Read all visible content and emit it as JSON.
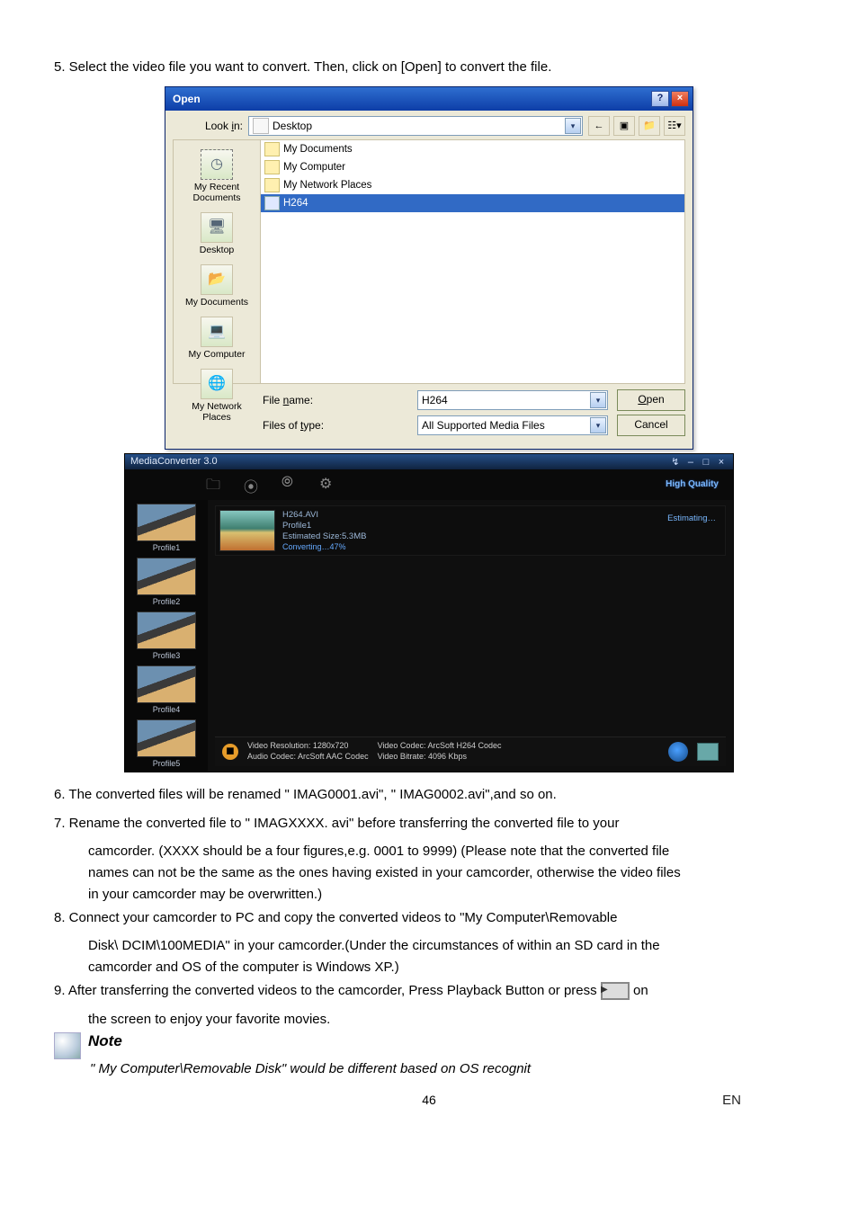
{
  "steps": {
    "s5": "5. Select the video file you want to convert. Then, click on [Open] to convert the file.",
    "s6": "6. The converted files will be renamed \" IMAG0001.avi\", \" IMAG0002.avi\",and so on.",
    "s7a": "7. Rename the converted file to \" IMAGXXXX. avi\" before transferring the converted file to your",
    "s7b": "camcorder. (XXXX should be a four figures,e.g. 0001 to 9999) (Please note that the converted file",
    "s7c": "names can not be the same as the ones having existed in your camcorder, otherwise the video files",
    "s7d": "in your camcorder may be overwritten.)",
    "s8a": "8. Connect your camcorder to PC and copy the converted videos to \"My Computer\\Removable",
    "s8b": "Disk\\ DCIM\\100MEDIA\" in your camcorder.(Under the circumstances of within an SD card in the",
    "s8c": "camcorder and OS of the computer is Windows XP.)",
    "s9a": "9. After transferring the converted videos to the camcorder, Press Playback Button or press ",
    "s9b": " on",
    "s9c": "the screen to enjoy your favorite movies."
  },
  "note": {
    "title": "Note",
    "body": "\" My Computer\\Removable Disk\" would be different based on OS recognit"
  },
  "open": {
    "title": "Open",
    "lookin_label": "Look in:",
    "lookin_value": "Desktop",
    "places": {
      "recent": "My Recent Documents",
      "desktop": "Desktop",
      "mydocs": "My Documents",
      "mycomp": "My Computer",
      "mynet": "My Network Places"
    },
    "items": {
      "mydocs": "My Documents",
      "mycomp": "My Computer",
      "mynet": "My Network Places",
      "h264": "H264"
    },
    "filename_label": "File name:",
    "filename_value": "H264",
    "filetype_label": "Files of type:",
    "filetype_value": "All Supported Media Files",
    "open_btn": "Open",
    "cancel_btn": "Cancel"
  },
  "mc": {
    "title": "MediaConverter 3.0",
    "hq": "High Quality",
    "profiles": [
      "Profile1",
      "Profile2",
      "Profile3",
      "Profile4",
      "Profile5"
    ],
    "item": {
      "name": "H264.AVI",
      "profile": "Profile1",
      "size": "Estimated Size:5.3MB",
      "progress": "Converting…47%",
      "estimating": "Estimating…"
    },
    "status": {
      "res": "Video Resolution: 1280x720",
      "acodec": "Audio Codec: ArcSoft AAC Codec",
      "vcodec": "Video Codec: ArcSoft H264 Codec",
      "vbitrate": "Video Bitrate: 4096 Kbps"
    }
  },
  "page": {
    "num": "46",
    "lang": "EN"
  }
}
